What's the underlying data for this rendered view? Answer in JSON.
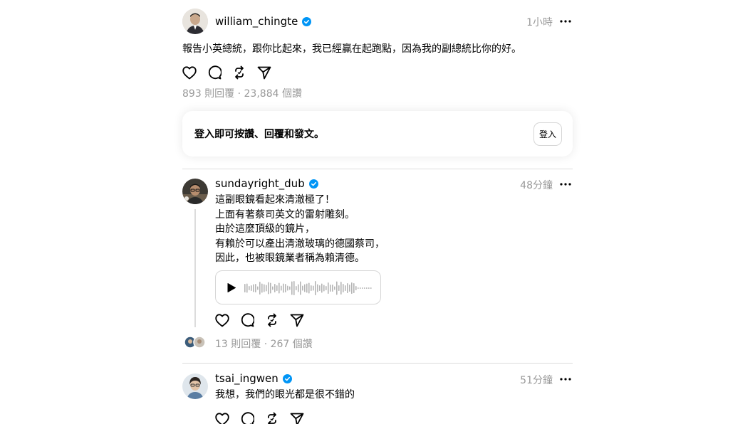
{
  "posts": {
    "main": {
      "username": "william_chingte",
      "time": "1小時",
      "text": "報告小英總統，跟你比起來，我已經贏在起跑點，因為我的副總統比你的好。",
      "stats": "893 則回覆 · 23,884 個讚"
    },
    "login": {
      "prompt": "登入即可按讚、回覆和發文。",
      "button": "登入"
    },
    "reply1": {
      "username": "sundayright_dub",
      "time": "48分鐘",
      "lines": [
        "這副眼鏡看起來清澈極了！",
        "上面有著蔡司英文的雷射雕刻。",
        "由於這麼頂級的鏡片，",
        "有賴於可以產出清澈玻璃的德國蔡司，",
        "因此，也被眼鏡業者稱為賴清德。"
      ],
      "stats": "13 則回覆 · 267 個讚"
    },
    "reply2": {
      "username": "tsai_ingwen",
      "time": "51分鐘",
      "text": "我想，我們的眼光都是很不錯的"
    }
  },
  "colors": {
    "verified": "#0095f6",
    "muted": "#999999",
    "divider": "#dcdcdc"
  },
  "icons": [
    "heart-icon",
    "comment-icon",
    "repost-icon",
    "share-icon",
    "more-icon",
    "verified-icon",
    "play-icon"
  ]
}
